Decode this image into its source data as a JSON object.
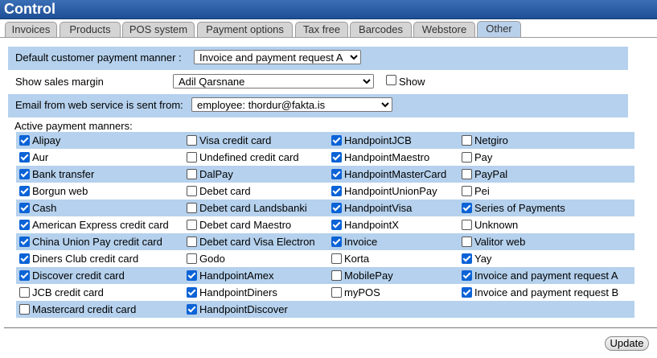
{
  "title": "Control",
  "tabs": [
    {
      "label": "Invoices",
      "active": false
    },
    {
      "label": "Products",
      "active": false
    },
    {
      "label": "POS system",
      "active": false
    },
    {
      "label": "Payment options",
      "active": false
    },
    {
      "label": "Tax free",
      "active": false
    },
    {
      "label": "Barcodes",
      "active": false
    },
    {
      "label": "Webstore",
      "active": false
    },
    {
      "label": "Other",
      "active": true
    }
  ],
  "settings": {
    "default_payment_label": "Default customer payment manner :",
    "default_payment_value": "Invoice and payment request A",
    "sales_margin_label": "Show sales margin",
    "sales_margin_user": "Adil Qarsnane",
    "sales_margin_show_label": "Show",
    "sales_margin_show_checked": false,
    "email_label": "Email from web service is sent from:",
    "email_value": "employee: thordur@fakta.is"
  },
  "payment": {
    "heading": "Active payment manners:",
    "columns": [
      [
        {
          "label": "Alipay",
          "checked": true
        },
        {
          "label": "Aur",
          "checked": true
        },
        {
          "label": "Bank transfer",
          "checked": true
        },
        {
          "label": "Borgun web",
          "checked": true
        },
        {
          "label": "Cash",
          "checked": true
        },
        {
          "label": "American Express credit card",
          "checked": true
        },
        {
          "label": "China Union Pay credit card",
          "checked": true
        },
        {
          "label": "Diners Club credit card",
          "checked": true
        },
        {
          "label": "Discover credit card",
          "checked": true
        },
        {
          "label": "JCB credit card",
          "checked": false
        },
        {
          "label": "Mastercard credit card",
          "checked": false
        }
      ],
      [
        {
          "label": "Visa credit card",
          "checked": false
        },
        {
          "label": "Undefined credit card",
          "checked": false
        },
        {
          "label": "DalPay",
          "checked": false
        },
        {
          "label": "Debet card",
          "checked": false
        },
        {
          "label": "Debet card Landsbanki",
          "checked": false
        },
        {
          "label": "Debet card Maestro",
          "checked": false
        },
        {
          "label": "Debet card Visa Electron",
          "checked": false
        },
        {
          "label": "Godo",
          "checked": false
        },
        {
          "label": "HandpointAmex",
          "checked": true
        },
        {
          "label": "HandpointDiners",
          "checked": true
        },
        {
          "label": "HandpointDiscover",
          "checked": true
        }
      ],
      [
        {
          "label": "HandpointJCB",
          "checked": true
        },
        {
          "label": "HandpointMaestro",
          "checked": true
        },
        {
          "label": "HandpointMasterCard",
          "checked": true
        },
        {
          "label": "HandpointUnionPay",
          "checked": true
        },
        {
          "label": "HandpointVisa",
          "checked": true
        },
        {
          "label": "HandpointX",
          "checked": true
        },
        {
          "label": "Invoice",
          "checked": true
        },
        {
          "label": "Korta",
          "checked": false
        },
        {
          "label": "MobilePay",
          "checked": false
        },
        {
          "label": "myPOS",
          "checked": false
        }
      ],
      [
        {
          "label": "Netgiro",
          "checked": false
        },
        {
          "label": "Pay",
          "checked": false
        },
        {
          "label": "PayPal",
          "checked": false
        },
        {
          "label": "Pei",
          "checked": false
        },
        {
          "label": "Series of Payments",
          "checked": true
        },
        {
          "label": "Unknown",
          "checked": false
        },
        {
          "label": "Valitor web",
          "checked": false
        },
        {
          "label": "Yay",
          "checked": true
        },
        {
          "label": "Invoice and payment request A",
          "checked": true
        },
        {
          "label": "Invoice and payment request B",
          "checked": true
        }
      ]
    ]
  },
  "update_label": "Update",
  "colors": {
    "accent": "#1e4f96",
    "band": "#b5d1ed",
    "tab": "#d4d4d4",
    "tab_active": "#b9d0ea",
    "checkbox_on": "#0b63d6"
  }
}
